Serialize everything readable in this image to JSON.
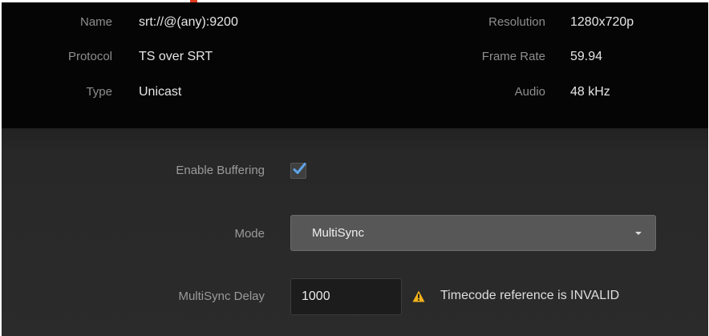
{
  "info": {
    "name_label": "Name",
    "name_value": "srt://@(any):9200",
    "protocol_label": "Protocol",
    "protocol_value": "TS over SRT",
    "type_label": "Type",
    "type_value": "Unicast",
    "resolution_label": "Resolution",
    "resolution_value": "1280x720p",
    "frame_rate_label": "Frame Rate",
    "frame_rate_value": "59.94",
    "audio_label": "Audio",
    "audio_value": "48 kHz"
  },
  "settings": {
    "enable_buffering_label": "Enable Buffering",
    "enable_buffering_checked": true,
    "mode_label": "Mode",
    "mode_value": "MultiSync",
    "delay_label": "MultiSync Delay",
    "delay_value": "1000",
    "warning_text": "Timecode reference is INVALID"
  },
  "colors": {
    "checkmark": "#5ea3e8",
    "warning": "#f2b21b",
    "accent_mark": "#e23a1f"
  },
  "icons": {
    "checkbox": "checkmark-icon",
    "dropdown": "chevron-down-icon",
    "warning": "warning-triangle-icon"
  }
}
